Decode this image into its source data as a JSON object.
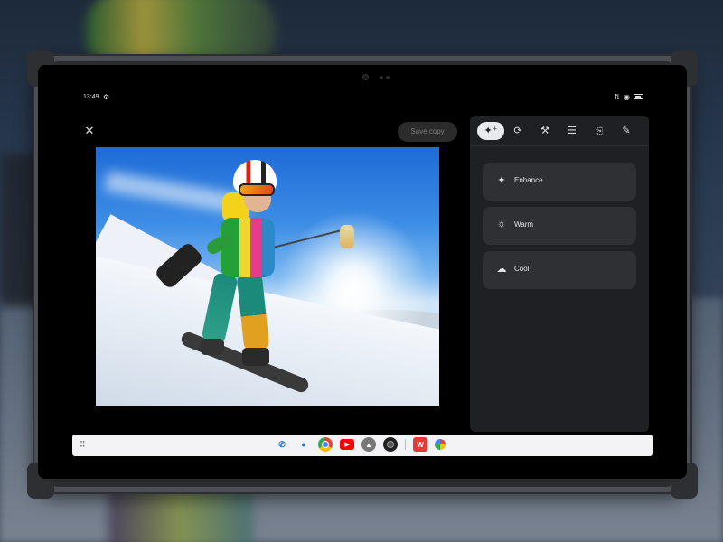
{
  "status_bar": {
    "time": "13:49",
    "gear_glyph": "⚙",
    "icons": [
      "signal-icon",
      "wifi-icon",
      "battery-icon"
    ],
    "signal_glyph": "⇅",
    "wifi_glyph": "◉"
  },
  "editor": {
    "close_glyph": "✕",
    "save_copy_label": "Save copy"
  },
  "toolbar": {
    "tools": [
      {
        "name": "suggestions-tool",
        "glyph": "✦⁺",
        "active": true
      },
      {
        "name": "crop-rotate-tool",
        "glyph": "⟳"
      },
      {
        "name": "tools-tool",
        "glyph": "⚒"
      },
      {
        "name": "adjust-tool",
        "glyph": "☰"
      },
      {
        "name": "filters-tool",
        "glyph": "⎘"
      },
      {
        "name": "markup-tool",
        "glyph": "✎"
      }
    ]
  },
  "suggestions": [
    {
      "label": "Enhance",
      "icon": "sparkle-icon",
      "glyph": "✦"
    },
    {
      "label": "Warm",
      "icon": "sun-icon",
      "glyph": "☼"
    },
    {
      "label": "Cool",
      "icon": "cloud-icon",
      "glyph": "☁"
    }
  ],
  "taskbar": {
    "launcher_glyph": "⠿",
    "apps": [
      {
        "name": "phone",
        "glyph": "✆"
      },
      {
        "name": "messages",
        "glyph": "●"
      },
      {
        "name": "chrome",
        "glyph": ""
      },
      {
        "name": "youtube",
        "glyph": "▶"
      },
      {
        "name": "drive",
        "glyph": "▲"
      },
      {
        "name": "camera",
        "glyph": ""
      },
      {
        "name": "wps-office",
        "glyph": "W"
      },
      {
        "name": "photos",
        "glyph": ""
      }
    ]
  }
}
